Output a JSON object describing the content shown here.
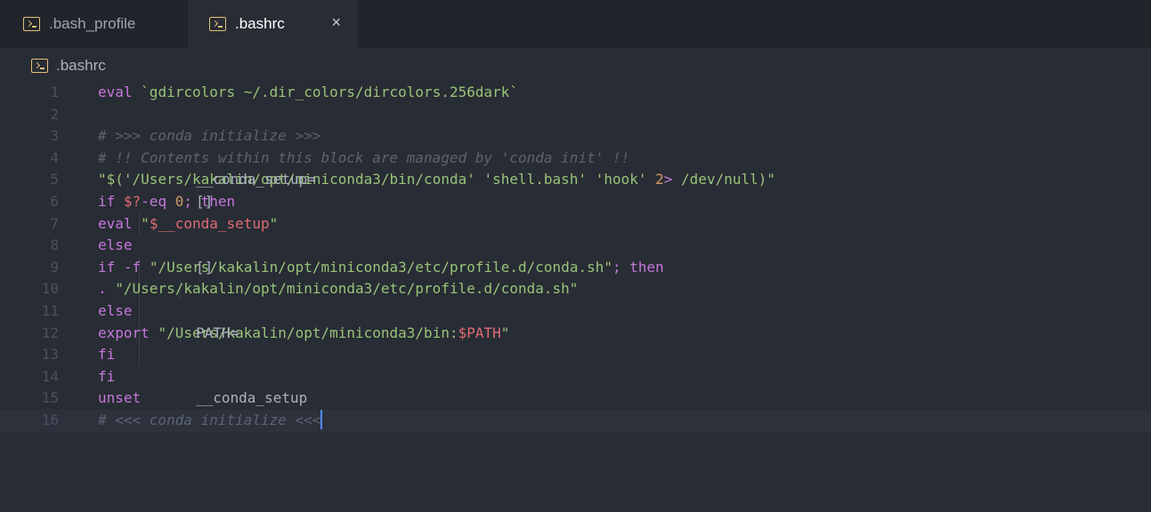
{
  "tabs": [
    {
      "label": ".bash_profile",
      "icon": "terminal-icon",
      "active": false
    },
    {
      "label": ".bashrc",
      "icon": "terminal-icon",
      "active": true,
      "close": "×"
    }
  ],
  "breadcrumb": {
    "label": ".bashrc",
    "icon": "terminal-icon"
  },
  "colors": {
    "background": "#282c34",
    "tabbar": "#21252b",
    "keyword": "#c678dd",
    "string": "#98c379",
    "variable": "#e06c75",
    "number": "#d19a66",
    "comment": "#5c6370",
    "icon": "#e5c07b",
    "cursor": "#528bff"
  },
  "lines": [
    {
      "n": "1",
      "tokens": [
        [
          "kw",
          "eval "
        ],
        [
          "str",
          "`gdircolors ~/.dir_colors/dircolors.256dark`"
        ]
      ]
    },
    {
      "n": "2",
      "tokens": []
    },
    {
      "n": "3",
      "tokens": [
        [
          "cmt",
          "# >>> conda initialize >>>"
        ]
      ]
    },
    {
      "n": "4",
      "tokens": [
        [
          "cmt",
          "# !! Contents within this block are managed by 'conda init' !!"
        ]
      ]
    },
    {
      "n": "5",
      "tokens": [
        [
          "txt",
          "__conda_setup="
        ],
        [
          "str",
          "\"$("
        ],
        [
          "str",
          "'/Users/kakalin/opt/miniconda3/bin/conda' 'shell.bash' 'hook' "
        ],
        [
          "num",
          "2"
        ],
        [
          "kw",
          "> "
        ],
        [
          "str",
          "/dev/null)\""
        ]
      ]
    },
    {
      "n": "6",
      "tokens": [
        [
          "kw",
          "if "
        ],
        [
          "txt",
          "[ "
        ],
        [
          "var",
          "$?"
        ],
        [
          "txt",
          " "
        ],
        [
          "kw",
          "-eq "
        ],
        [
          "num",
          "0"
        ],
        [
          "txt",
          " ]"
        ],
        [
          "kw",
          "; then"
        ]
      ]
    },
    {
      "n": "7",
      "tokens": [
        [
          "txt",
          "    "
        ],
        [
          "kw",
          "eval "
        ],
        [
          "str",
          "\""
        ],
        [
          "var",
          "$__conda_setup"
        ],
        [
          "str",
          "\""
        ]
      ]
    },
    {
      "n": "8",
      "tokens": [
        [
          "kw",
          "else"
        ]
      ]
    },
    {
      "n": "9",
      "tokens": [
        [
          "txt",
          "    "
        ],
        [
          "kw",
          "if "
        ],
        [
          "txt",
          "[ "
        ],
        [
          "kw",
          "-f "
        ],
        [
          "str",
          "\"/Users/kakalin/opt/miniconda3/etc/profile.d/conda.sh\""
        ],
        [
          "txt",
          " ]"
        ],
        [
          "kw",
          "; then"
        ]
      ]
    },
    {
      "n": "10",
      "tokens": [
        [
          "txt",
          "        "
        ],
        [
          "kw",
          ". "
        ],
        [
          "str",
          "\"/Users/kakalin/opt/miniconda3/etc/profile.d/conda.sh\""
        ]
      ]
    },
    {
      "n": "11",
      "tokens": [
        [
          "txt",
          "    "
        ],
        [
          "kw",
          "else"
        ]
      ]
    },
    {
      "n": "12",
      "tokens": [
        [
          "txt",
          "        "
        ],
        [
          "kw",
          "export "
        ],
        [
          "txt",
          "PATH="
        ],
        [
          "str",
          "\"/Users/kakalin/opt/miniconda3/bin:"
        ],
        [
          "var",
          "$PATH"
        ],
        [
          "str",
          "\""
        ]
      ]
    },
    {
      "n": "13",
      "tokens": [
        [
          "txt",
          "    "
        ],
        [
          "kw",
          "fi"
        ]
      ]
    },
    {
      "n": "14",
      "tokens": [
        [
          "kw",
          "fi"
        ]
      ]
    },
    {
      "n": "15",
      "tokens": [
        [
          "kw",
          "unset "
        ],
        [
          "txt",
          "__conda_setup"
        ]
      ]
    },
    {
      "n": "16",
      "tokens": [
        [
          "cmt",
          "# <<< conda initialize <<<"
        ]
      ],
      "active": true,
      "cursor": true
    }
  ]
}
